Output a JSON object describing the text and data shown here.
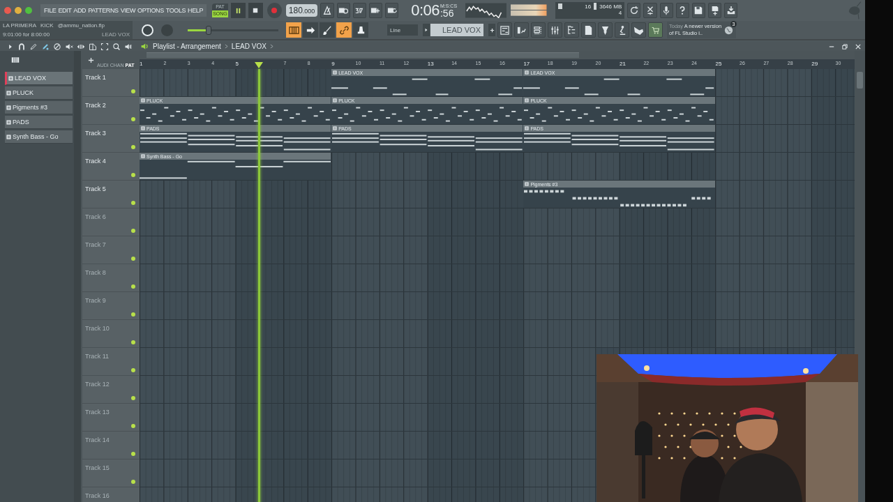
{
  "menu": [
    "FILE",
    "EDIT",
    "ADD",
    "PATTERNS",
    "VIEW",
    "OPTIONS",
    "TOOLS",
    "HELP"
  ],
  "transport": {
    "modes": [
      {
        "label": "PAT",
        "selected": false
      },
      {
        "label": "SONG",
        "selected": true
      }
    ],
    "playing": true,
    "tempo": "180",
    "tempo_fraction": ".000",
    "time": "0:06",
    "time_fraction": ":56",
    "time_format": "M:S:CS"
  },
  "memory": {
    "polyphony": "16",
    "ram": "3646 MB",
    "cpu": "4"
  },
  "hint": {
    "date": "Today",
    "message": "A newer version of FL Studio i..",
    "badge": "3"
  },
  "song_info": {
    "title": "LA PRIMERA",
    "channel": "KICK",
    "file": "@ammu_nation.flp",
    "time": "9:01:00 for 8:00:00",
    "target": "LEAD VOX"
  },
  "master_volume": {
    "level": 0.23
  },
  "tool_toggles": [
    {
      "on": true
    },
    {
      "on": false
    },
    {
      "on": false
    },
    {
      "on": true
    },
    {
      "on": false
    }
  ],
  "snap": "Line",
  "pattern": "LEAD VOX",
  "playlist": {
    "title": "Playlist - Arrangement",
    "crumb": "LEAD VOX",
    "picker_tabs": [
      {
        "label": "AUDI",
        "selected": false
      },
      {
        "label": "CHAN",
        "selected": false
      },
      {
        "label": "PAT",
        "selected": true
      }
    ],
    "patterns": [
      {
        "name": "LEAD VOX",
        "selected": true
      },
      {
        "name": "PLUCK",
        "selected": false
      },
      {
        "name": "Pigments #3",
        "selected": false
      },
      {
        "name": "PADS",
        "selected": false
      },
      {
        "name": "Synth Bass - Go",
        "selected": false
      }
    ],
    "ruler": [
      "1",
      "2",
      "3",
      "4",
      "5"
    ],
    "ruler_after_playhead": [
      "7",
      "8",
      "9",
      "10",
      "11",
      "12",
      "13",
      "14",
      "15",
      "16",
      "17",
      "18",
      "19",
      "20",
      "21",
      "22",
      "23",
      "24",
      "25",
      "26",
      "27",
      "28",
      "29",
      "30"
    ],
    "playhead": {
      "level": 0.167
    },
    "tracks": [
      {
        "name": "Track 1",
        "clip_slots": [
          {
            "kind": "empty"
          },
          {
            "label": "LEAD VOX",
            "kind": "lead"
          },
          {
            "label": "LEAD VOX",
            "kind": "lead"
          }
        ]
      },
      {
        "name": "Track 2",
        "clip_slots": [
          {
            "label": "PLUCK",
            "kind": "pluck"
          },
          {
            "label": "PLUCK",
            "kind": "pluck"
          },
          {
            "label": "PLUCK",
            "kind": "pluck"
          }
        ]
      },
      {
        "name": "Track 3",
        "clip_slots": [
          {
            "label": "PADS",
            "kind": "pads"
          },
          {
            "label": "PADS",
            "kind": "pads"
          },
          {
            "label": "PADS",
            "kind": "pads"
          }
        ]
      },
      {
        "name": "Track 4",
        "clip_slots": [
          {
            "label": "Synth Bass - Go",
            "kind": "bass"
          }
        ]
      },
      {
        "name": "Track 5",
        "clip_slots": [
          {
            "kind": "empty"
          },
          {
            "kind": "empty"
          },
          {
            "label": "Pigments #3",
            "kind": "arp"
          }
        ]
      },
      {
        "name": "Track 6"
      },
      {
        "name": "Track 7"
      },
      {
        "name": "Track 8"
      },
      {
        "name": "Track 9"
      },
      {
        "name": "Track 10"
      },
      {
        "name": "Track 11"
      },
      {
        "name": "Track 12"
      },
      {
        "name": "Track 13"
      },
      {
        "name": "Track 14"
      },
      {
        "name": "Track 15"
      },
      {
        "name": "Track 16"
      }
    ]
  }
}
